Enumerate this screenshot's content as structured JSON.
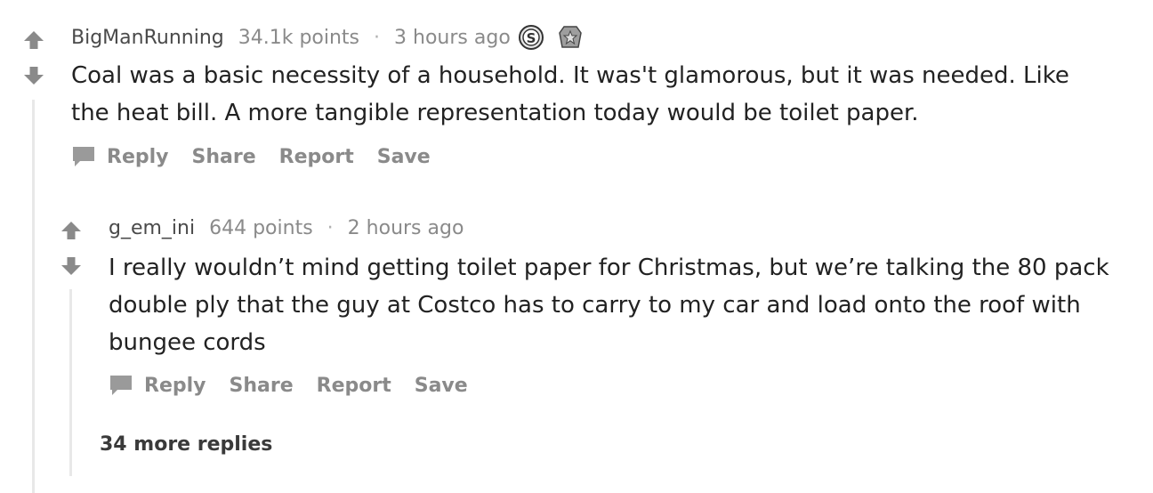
{
  "comment": {
    "author": "BigManRunning",
    "points": "34.1k points",
    "separator": "·",
    "time": "3 hours ago",
    "awards": [
      "silver-coin-award-icon",
      "star-award-icon"
    ],
    "body_line1": "Coal was a basic necessity of a household. It was't glamorous, but it was needed. Like",
    "body_line2": "the heat bill. A more tangible representation today would be toilet paper.",
    "actions": {
      "reply": "Reply",
      "share": "Share",
      "report": "Report",
      "save": "Save"
    }
  },
  "reply": {
    "author": "g_em_ini",
    "points": "644 points",
    "separator": "·",
    "time": "2 hours ago",
    "body_line1": "I really wouldn’t mind getting toilet paper for Christmas, but we’re talking the 80 pack",
    "body_line2": "double ply that the guy at Costco has to carry to my car and load onto the roof with",
    "body_line3": "bungee cords",
    "actions": {
      "reply": "Reply",
      "share": "Share",
      "report": "Report",
      "save": "Save"
    },
    "more_replies": "34 more replies"
  },
  "colors": {
    "vote_arrow": "#8a8a8a",
    "meta_text": "#8a8a8a",
    "thread_line": "#e8e8e8"
  }
}
